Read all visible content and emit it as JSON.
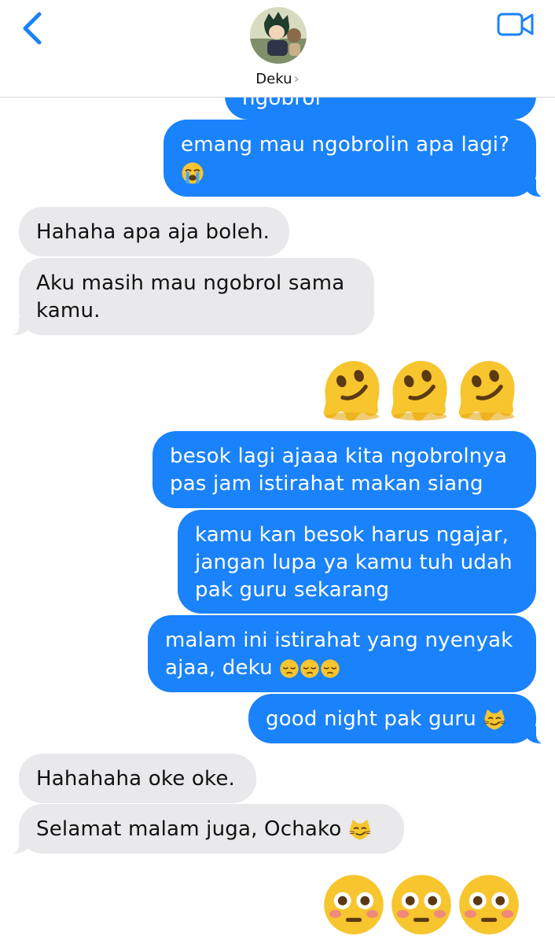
{
  "header": {
    "contact_name": "Deku",
    "chevron": "›",
    "back_icon": "chevron-left-icon",
    "video_icon": "video-camera-icon",
    "accent": "#1a82fb"
  },
  "messages": {
    "m0": "ngobrol",
    "m1": "emang mau ngobrolin apa lagi?",
    "m2": "Hahaha apa aja boleh.",
    "m3": "Aku masih mau ngobrol sama kamu.",
    "m5": "besok lagi ajaaa kita ngobrolnya pas jam istirahat makan siang",
    "m6": "kamu kan besok harus ngajar, jangan lupa ya kamu tuh udah pak guru sekarang",
    "m7": "malam ini istirahat yang nyenyak ajaa, deku",
    "m8": "good night pak guru",
    "m9": "Hahahaha oke oke.",
    "m10": "Selamat malam juga, Ochako"
  },
  "emojis": {
    "crying": "loudly-crying-face-icon",
    "melting": "melting-face-icon",
    "pensive": "pensive-face-icon",
    "smirk_cat": "smirking-cat-icon",
    "flushed": "flushed-face-icon"
  },
  "colors": {
    "outgoing": "#1a82fb",
    "incoming": "#e9e9eb"
  }
}
